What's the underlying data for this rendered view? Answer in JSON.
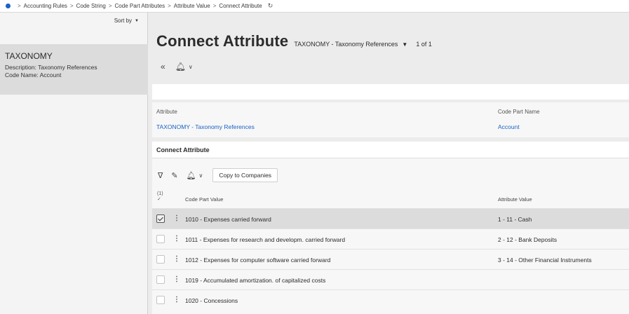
{
  "breadcrumb": {
    "items": [
      "Accounting Rules",
      "Code String",
      "Code Part Attributes",
      "Attribute Value",
      "Connect Attribute"
    ],
    "refresh_icon": "refresh-icon"
  },
  "left_panel": {
    "sort_label": "Sort by",
    "card": {
      "title": "TAXONOMY",
      "description": "Description:  Taxonomy References",
      "code_name": "Code Name:  Account"
    }
  },
  "header": {
    "title": "Connect Attribute",
    "context": "TAXONOMY - Taxonomy References",
    "record_count": "1 of 1"
  },
  "info": {
    "attribute_label": "Attribute",
    "attribute_value": "TAXONOMY - Taxonomy References",
    "code_part_label": "Code Part Name",
    "code_part_value": "Account"
  },
  "section": {
    "title": "Connect Attribute",
    "copy_button": "Copy to Companies"
  },
  "table": {
    "selected_count": "(1)",
    "columns": [
      "Code Part Value",
      "Attribute Value"
    ],
    "rows": [
      {
        "code_part_value": "1010 - Expenses carried forward",
        "attribute_value": "1 - 11 - Cash",
        "selected": true
      },
      {
        "code_part_value": "1011 - Expenses for research and developm. carried forward",
        "attribute_value": "2 - 12 - Bank Deposits",
        "selected": false
      },
      {
        "code_part_value": "1012 - Expenses for computer software carried forward",
        "attribute_value": "3 - 14 - Other Financial Instruments",
        "selected": false
      },
      {
        "code_part_value": "1019 - Accumulated amortization. of capitalized costs",
        "attribute_value": "",
        "selected": false
      },
      {
        "code_part_value": "1020 - Concessions",
        "attribute_value": "",
        "selected": false
      }
    ]
  },
  "colors": {
    "accent": "#1a62c6",
    "selected_row": "#dcdcdc",
    "background": "#ececec"
  }
}
